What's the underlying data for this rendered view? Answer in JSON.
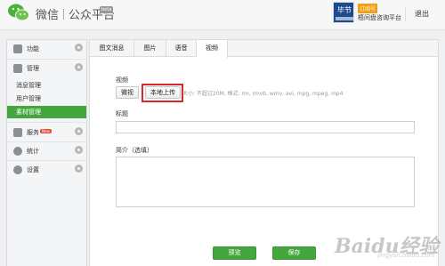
{
  "header": {
    "brand_name": "微信",
    "brand_sub": "公众平台",
    "beta": "beta",
    "account_avatar_text": "毕节",
    "account_type": "订阅号",
    "account_name": "梧间盘咨询平台",
    "logout": "退出"
  },
  "sidebar": {
    "function": "功能",
    "manage": "管理",
    "sub_items": [
      "消息管理",
      "用户管理",
      "素材管理"
    ],
    "service": "服务",
    "service_badge": "New",
    "stats": "统计",
    "settings": "设置"
  },
  "tabs": [
    "图文消息",
    "图片",
    "语音",
    "视频"
  ],
  "form": {
    "video_label": "视频",
    "microvideo_btn": "微视",
    "upload_btn": "本地上传",
    "hint": "大小: 不超过20M,   格式: rm, rmvb, wmv, avi, mpg, mpeg, mp4",
    "title_label": "标题",
    "intro_label": "简介（选填）",
    "preview_btn": "预览",
    "save_btn": "保存"
  },
  "watermark": {
    "text": "Baidu经验",
    "sub": "jingyan.baidu.com"
  },
  "colors": {
    "accent_green": "#44a73e",
    "highlight_red": "#d8262c",
    "badge_orange": "#f29d12"
  }
}
